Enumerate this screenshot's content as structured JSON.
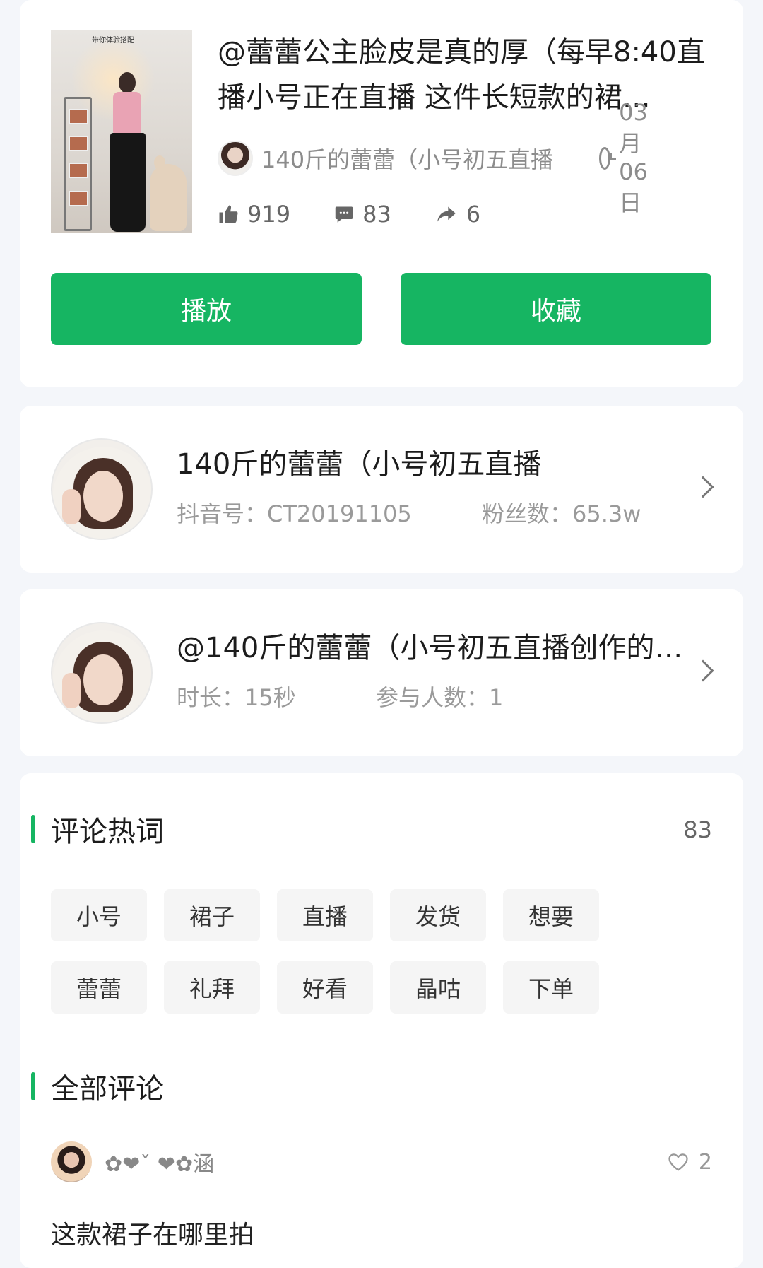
{
  "video": {
    "thumbnail_caption": "带你体验搭配",
    "title": "@蕾蕾公主脸皮是真的厚（每早8:40直播小号正在直播 这件长短款的裙…",
    "author": "140斤的蕾蕾（小号初五直播",
    "date": "03月06日",
    "likes": "919",
    "comments": "83",
    "shares": "6"
  },
  "actions": {
    "play_label": "播放",
    "favorite_label": "收藏"
  },
  "author_card": {
    "name": "140斤的蕾蕾（小号初五直播",
    "douyin_id": "抖音号：CT20191105",
    "fans": "粉丝数：65.3w"
  },
  "challenge_card": {
    "title": "@140斤的蕾蕾（小号初五直播创作的…",
    "duration": "时长：15秒",
    "participants": "参与人数：1"
  },
  "hot_words": {
    "title": "评论热词",
    "count": "83",
    "tags": [
      "小号",
      "裙子",
      "直播",
      "发货",
      "想要",
      "蕾蕾",
      "礼拜",
      "好看",
      "晶咕",
      "下单"
    ]
  },
  "all_comments": {
    "title": "全部评论",
    "items": [
      {
        "user": "✿❤ˇ ❤✿涵",
        "likes": "2",
        "text": "这款裙子在哪里拍"
      }
    ]
  },
  "colors": {
    "accent": "#16b562",
    "page_bg": "#f4f6fa",
    "muted_text": "#8c8c8c"
  }
}
